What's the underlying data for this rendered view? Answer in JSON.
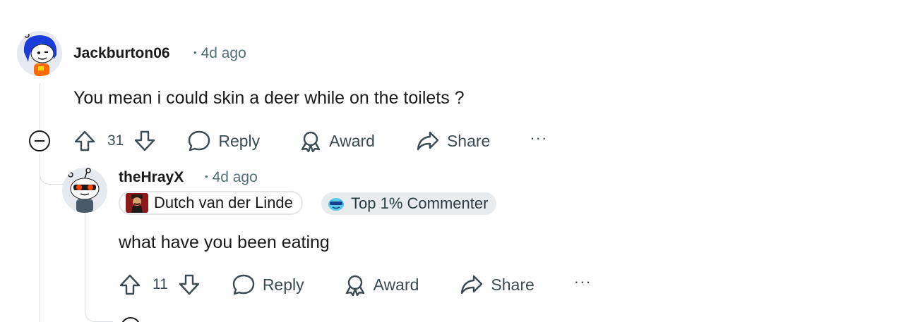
{
  "comments": [
    {
      "username": "Jackburton06",
      "separator": "•",
      "age": "4d ago",
      "text": "You mean i could skin a deer while on the toilets ?",
      "votes": "31",
      "actions": {
        "reply": "Reply",
        "award": "Award",
        "share": "Share",
        "more": "···"
      }
    },
    {
      "username": "theHrayX",
      "separator": "•",
      "age": "4d ago",
      "flairs": [
        {
          "label": "Dutch van der Linde",
          "icon": "portrait-icon"
        },
        {
          "label": "Top 1% Commenter",
          "icon": "top-commenter-icon"
        }
      ],
      "text": "what have you been eating",
      "votes": "11",
      "actions": {
        "reply": "Reply",
        "award": "Award",
        "share": "Share",
        "more": "···"
      }
    }
  ],
  "colors": {
    "text": "#1a1a1b",
    "meta": "#576f76",
    "action": "#3c4a52",
    "thread_line": "#dadde1",
    "avatar1_bg": "#1a3cd8",
    "avatar2_accent": "#ff4500"
  }
}
